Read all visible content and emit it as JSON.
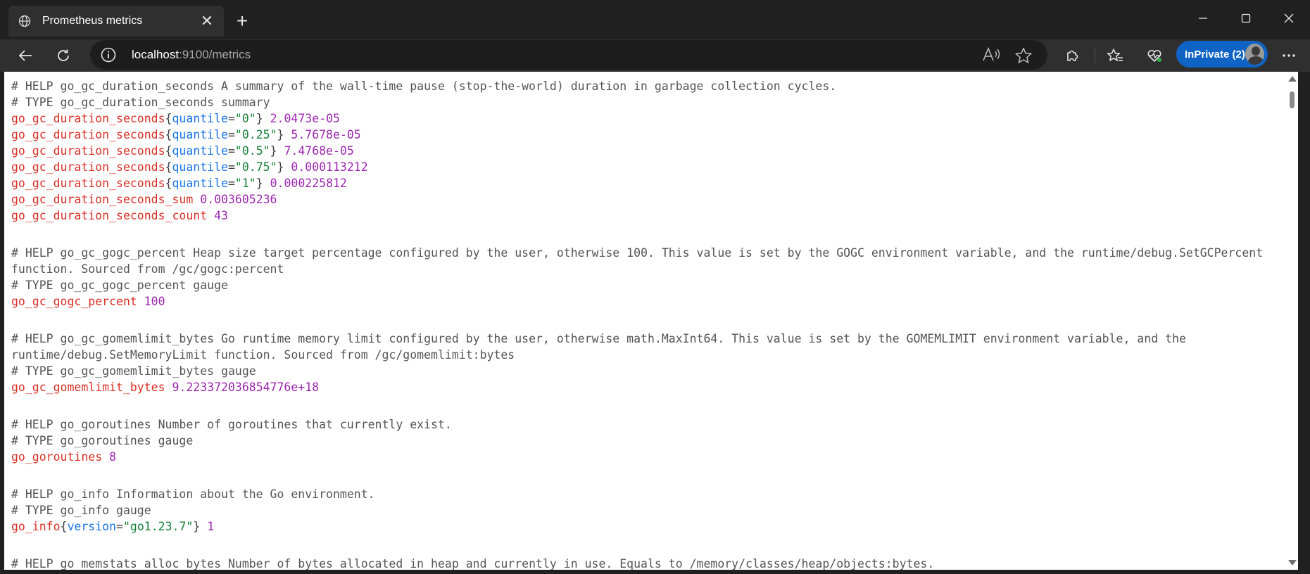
{
  "tab": {
    "title": "Prometheus metrics",
    "close": "✕"
  },
  "newtab": {
    "glyph": "+"
  },
  "address": {
    "host": "localhost",
    "rest": ":9100/metrics"
  },
  "profile": {
    "label": "InPrivate (2)"
  },
  "metrics": {
    "gc_help": "# HELP go_gc_duration_seconds A summary of the wall-time pause (stop-the-world) duration in garbage collection cycles.",
    "gc_type": "# TYPE go_gc_duration_seconds summary",
    "gc_name": "go_gc_duration_seconds",
    "quantile_label": "quantile",
    "q0": "\"0\"",
    "q0_val": "2.0473e-05",
    "q25": "\"0.25\"",
    "q25_val": "5.7678e-05",
    "q50": "\"0.5\"",
    "q50_val": "7.4768e-05",
    "q75": "\"0.75\"",
    "q75_val": "0.000113212",
    "q1": "\"1\"",
    "q1_val": "0.000225812",
    "gc_sum_name": "go_gc_duration_seconds_sum",
    "gc_sum_val": "0.003605236",
    "gc_count_name": "go_gc_duration_seconds_count",
    "gc_count_val": "43",
    "gogc_help": "# HELP go_gc_gogc_percent Heap size target percentage configured by the user, otherwise 100. This value is set by the GOGC environment variable, and the runtime/debug.SetGCPercent function. Sourced from /gc/gogc:percent",
    "gogc_type": "# TYPE go_gc_gogc_percent gauge",
    "gogc_name": "go_gc_gogc_percent",
    "gogc_val": "100",
    "memlimit_help": "# HELP go_gc_gomemlimit_bytes Go runtime memory limit configured by the user, otherwise math.MaxInt64. This value is set by the GOMEMLIMIT environment variable, and the runtime/debug.SetMemoryLimit function. Sourced from /gc/gomemlimit:bytes",
    "memlimit_type": "# TYPE go_gc_gomemlimit_bytes gauge",
    "memlimit_name": "go_gc_gomemlimit_bytes",
    "memlimit_val": "9.223372036854776e+18",
    "goroutines_help": "# HELP go_goroutines Number of goroutines that currently exist.",
    "goroutines_type": "# TYPE go_goroutines gauge",
    "goroutines_name": "go_goroutines",
    "goroutines_val": "8",
    "info_help": "# HELP go_info Information about the Go environment.",
    "info_type": "# TYPE go_info gauge",
    "info_name": "go_info",
    "version_label": "version",
    "version_val": "\"go1.23.7\"",
    "info_val": "1",
    "alloc_help": "# HELP go_memstats_alloc_bytes Number of bytes allocated in heap and currently in use. Equals to /memory/classes/heap/objects:bytes."
  }
}
